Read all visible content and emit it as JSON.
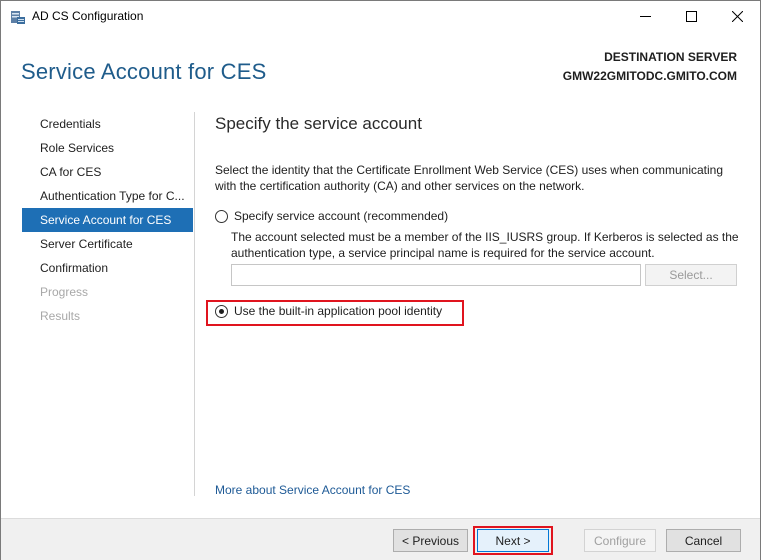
{
  "window": {
    "title": "AD CS Configuration",
    "icon": "server-manager-icon",
    "controls": {
      "minimize": "—",
      "maximize": "☐",
      "close": "✕"
    }
  },
  "header": {
    "page_title": "Service Account for CES",
    "destination_label": "DESTINATION SERVER",
    "destination_server": "GMW22GMITODC.GMITO.COM"
  },
  "nav": {
    "items": [
      {
        "label": "Credentials",
        "state": "normal"
      },
      {
        "label": "Role Services",
        "state": "normal"
      },
      {
        "label": "CA for CES",
        "state": "normal"
      },
      {
        "label": "Authentication Type for C...",
        "state": "normal"
      },
      {
        "label": "Service Account for CES",
        "state": "selected"
      },
      {
        "label": "Server Certificate",
        "state": "normal"
      },
      {
        "label": "Confirmation",
        "state": "normal"
      },
      {
        "label": "Progress",
        "state": "disabled"
      },
      {
        "label": "Results",
        "state": "disabled"
      }
    ]
  },
  "content": {
    "section_title": "Specify the service account",
    "description": "Select the identity that the Certificate Enrollment Web Service (CES) uses when communicating with the certification authority (CA) and other services on the network.",
    "option_specify": {
      "label": "Specify service account (recommended)",
      "checked": false,
      "note": "The account selected must be a member of the IIS_IUSRS group. If Kerberos is selected as the authentication type, a service principal name is required for the service account.",
      "account_value": "",
      "select_button": "Select..."
    },
    "option_builtin": {
      "label": "Use the built-in application pool identity",
      "checked": true
    },
    "more_link": "More about Service Account for CES"
  },
  "footer": {
    "previous": "< Previous",
    "next": "Next >",
    "configure": "Configure",
    "cancel": "Cancel"
  },
  "colors": {
    "title_blue": "#1f5c8b",
    "nav_selected": "#1e6fb5",
    "highlight_red": "#e0141e",
    "link_blue": "#1e5a96"
  }
}
